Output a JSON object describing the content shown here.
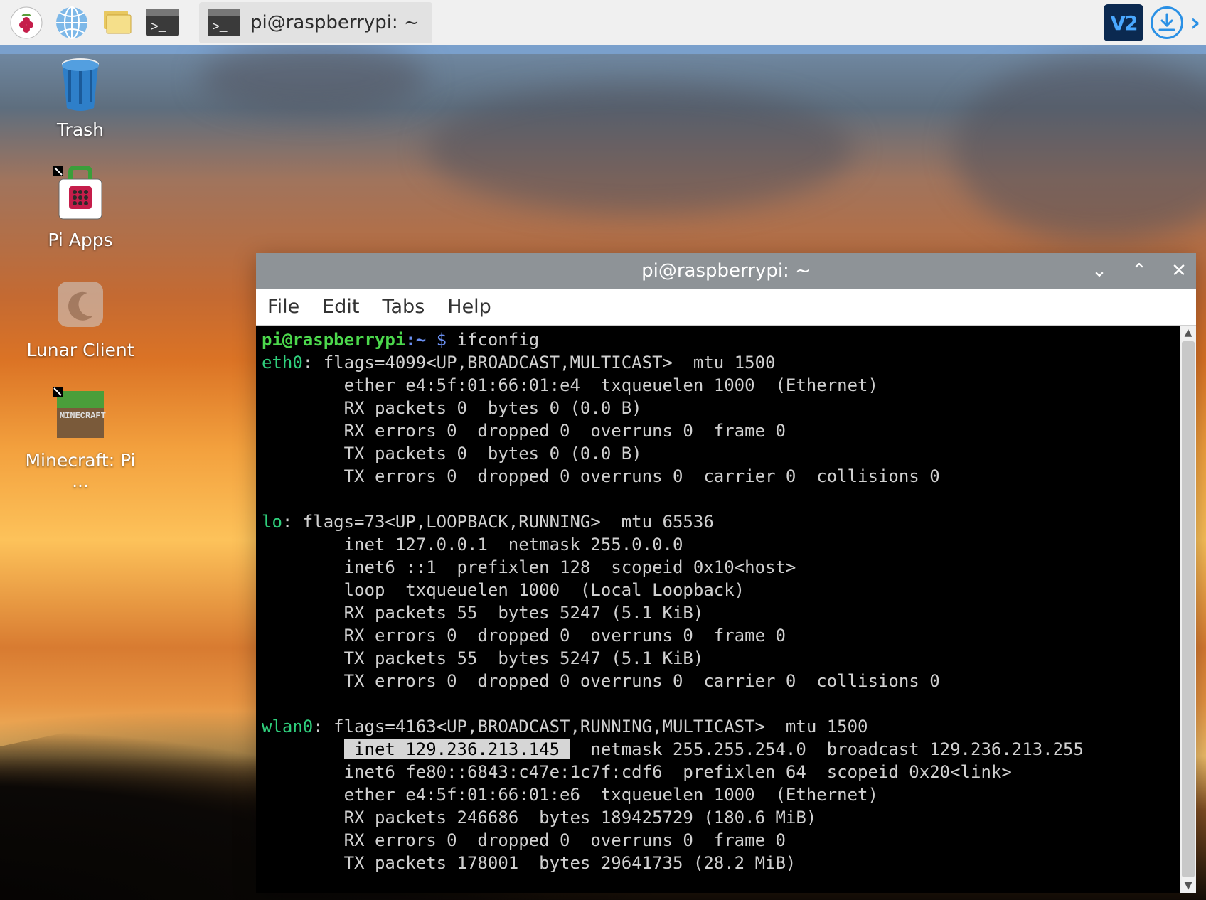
{
  "taskbar": {
    "app_icons": [
      {
        "name": "raspberry-menu-icon"
      },
      {
        "name": "web-browser-icon"
      },
      {
        "name": "file-manager-icon"
      },
      {
        "name": "terminal-launcher-icon"
      }
    ],
    "task_item": {
      "icon": "terminal-icon",
      "title": "pi@raspberrypi: ~"
    },
    "tray": {
      "vnc_label": "V2",
      "download_icon": "download-icon",
      "next_icon": "chevron-right-icon"
    }
  },
  "desktop": {
    "icons": [
      {
        "name": "trash-icon",
        "label": "Trash"
      },
      {
        "name": "pi-apps-icon",
        "label": "Pi Apps"
      },
      {
        "name": "lunar-client-icon",
        "label": "Lunar Client"
      },
      {
        "name": "minecraft-pi-icon",
        "label": "Minecraft: Pi ..."
      }
    ]
  },
  "terminal": {
    "title": "pi@raspberrypi: ~",
    "menu": [
      "File",
      "Edit",
      "Tabs",
      "Help"
    ],
    "window_buttons": {
      "min": "⌄",
      "max": "⌃",
      "close": "✕"
    },
    "prompt": {
      "user_host": "pi@raspberrypi",
      "path": "~",
      "symbol": "$"
    },
    "command": "ifconfig",
    "output": {
      "eth0": {
        "header": "eth0: flags=4099<UP,BROADCAST,MULTICAST>  mtu 1500",
        "lines": [
          "        ether e4:5f:01:66:01:e4  txqueuelen 1000  (Ethernet)",
          "        RX packets 0  bytes 0 (0.0 B)",
          "        RX errors 0  dropped 0  overruns 0  frame 0",
          "        TX packets 0  bytes 0 (0.0 B)",
          "        TX errors 0  dropped 0 overruns 0  carrier 0  collisions 0"
        ]
      },
      "lo": {
        "header": "lo: flags=73<UP,LOOPBACK,RUNNING>  mtu 65536",
        "lines": [
          "        inet 127.0.0.1  netmask 255.0.0.0",
          "        inet6 ::1  prefixlen 128  scopeid 0x10<host>",
          "        loop  txqueuelen 1000  (Local Loopback)",
          "        RX packets 55  bytes 5247 (5.1 KiB)",
          "        RX errors 0  dropped 0  overruns 0  frame 0",
          "        TX packets 55  bytes 5247 (5.1 KiB)",
          "        TX errors 0  dropped 0 overruns 0  carrier 0  collisions 0"
        ]
      },
      "wlan0": {
        "header": "wlan0: flags=4163<UP,BROADCAST,RUNNING,MULTICAST>  mtu 1500",
        "inet_highlight": "inet 129.236.213.145",
        "inet_rest": "  netmask 255.255.254.0  broadcast 129.236.213.255",
        "lines": [
          "        inet6 fe80::6843:c47e:1c7f:cdf6  prefixlen 64  scopeid 0x20<link>",
          "        ether e4:5f:01:66:01:e6  txqueuelen 1000  (Ethernet)",
          "        RX packets 246686  bytes 189425729 (180.6 MiB)",
          "        RX errors 0  dropped 0  overruns 0  frame 0",
          "        TX packets 178001  bytes 29641735 (28.2 MiB)"
        ]
      }
    }
  }
}
